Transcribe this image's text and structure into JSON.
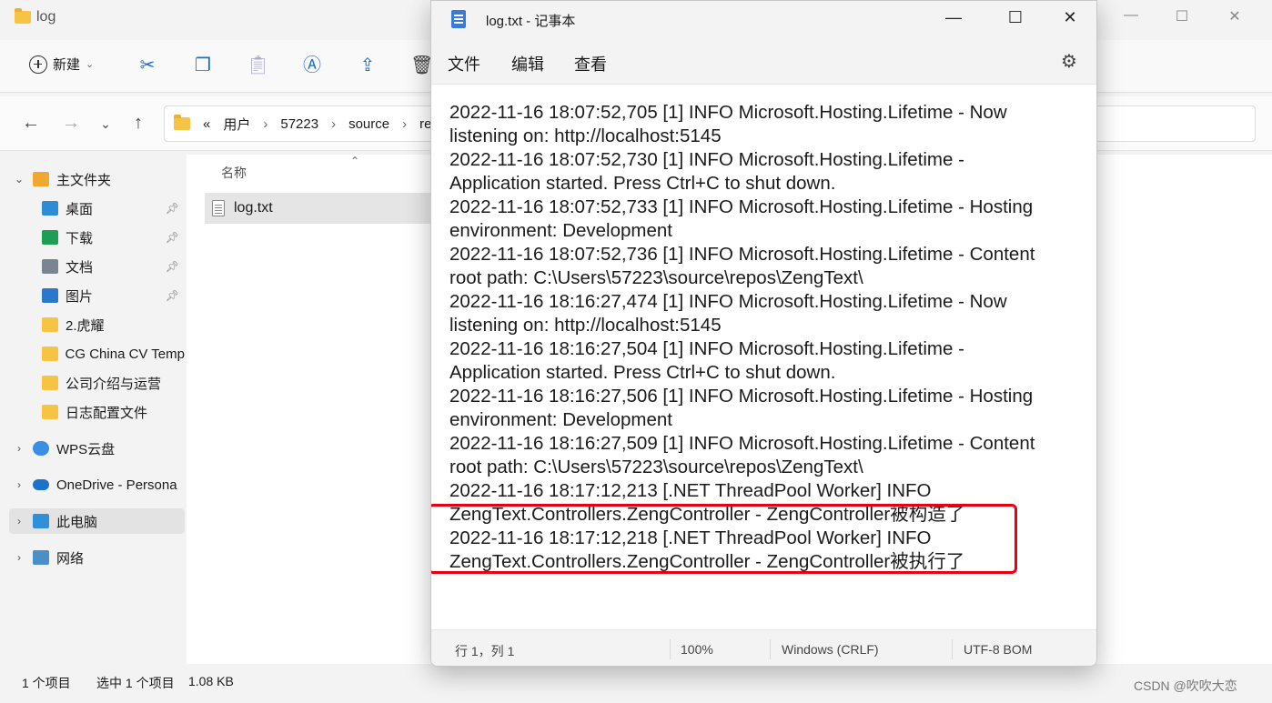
{
  "explorer": {
    "title": "log",
    "toolbar": {
      "new_label": "新建"
    },
    "address": {
      "crumbs": [
        "«",
        "用户",
        "57223",
        "source",
        "repo"
      ]
    },
    "sidebar": {
      "home": "主文件夹",
      "quick": [
        {
          "label": "桌面",
          "pinned": true,
          "icon": "desktop-icon",
          "color": "#2e8bd6"
        },
        {
          "label": "下载",
          "pinned": true,
          "icon": "download-icon",
          "color": "#1f9d55"
        },
        {
          "label": "文档",
          "pinned": true,
          "icon": "document-icon",
          "color": "#7a8594"
        },
        {
          "label": "图片",
          "pinned": true,
          "icon": "picture-icon",
          "color": "#2b77c9"
        },
        {
          "label": "2.虎耀",
          "pinned": false,
          "icon": "folder-icon",
          "color": "#f6c344"
        },
        {
          "label": "CG China CV Temp",
          "pinned": false,
          "icon": "folder-icon",
          "color": "#f6c344"
        },
        {
          "label": "公司介绍与运营",
          "pinned": false,
          "icon": "folder-icon",
          "color": "#f6c344"
        },
        {
          "label": "日志配置文件",
          "pinned": false,
          "icon": "folder-icon",
          "color": "#f6c344"
        }
      ],
      "wps": "WPS云盘",
      "onedrive": "OneDrive - Persona",
      "thispc": "此电脑",
      "network": "网络"
    },
    "list": {
      "col_name": "名称",
      "file": "log.txt"
    },
    "status": {
      "count": "1 个项目",
      "selected": "选中 1 个项目",
      "size": "1.08 KB"
    }
  },
  "notepad": {
    "title": "log.txt - 记事本",
    "menu": {
      "file": "文件",
      "edit": "编辑",
      "view": "查看"
    },
    "lines": [
      "2022-11-16 18:07:52,705 [1] INFO  Microsoft.Hosting.Lifetime - Now",
      "listening on: http://localhost:5145",
      "2022-11-16 18:07:52,730 [1] INFO  Microsoft.Hosting.Lifetime -",
      "Application started. Press Ctrl+C to shut down.",
      "2022-11-16 18:07:52,733 [1] INFO  Microsoft.Hosting.Lifetime - Hosting",
      "environment: Development",
      "2022-11-16 18:07:52,736 [1] INFO  Microsoft.Hosting.Lifetime - Content",
      "root path: C:\\Users\\57223\\source\\repos\\ZengText\\",
      "2022-11-16 18:16:27,474 [1] INFO  Microsoft.Hosting.Lifetime - Now",
      "listening on: http://localhost:5145",
      "2022-11-16 18:16:27,504 [1] INFO  Microsoft.Hosting.Lifetime -",
      "Application started. Press Ctrl+C to shut down.",
      "2022-11-16 18:16:27,506 [1] INFO  Microsoft.Hosting.Lifetime - Hosting",
      "environment: Development",
      "2022-11-16 18:16:27,509 [1] INFO  Microsoft.Hosting.Lifetime - Content",
      "root path: C:\\Users\\57223\\source\\repos\\ZengText\\",
      "2022-11-16 18:17:12,213 [.NET ThreadPool Worker] INFO",
      "ZengText.Controllers.ZengController - ZengController被构造了",
      "2022-11-16 18:17:12,218 [.NET ThreadPool Worker] INFO",
      "ZengText.Controllers.ZengController - ZengController被执行了"
    ],
    "status": {
      "position": "行 1，列 1",
      "zoom": "100%",
      "line_ending": "Windows (CRLF)",
      "encoding": "UTF-8 BOM"
    },
    "highlight_color": "#e60012"
  },
  "watermark": "CSDN @吹吹大恋"
}
